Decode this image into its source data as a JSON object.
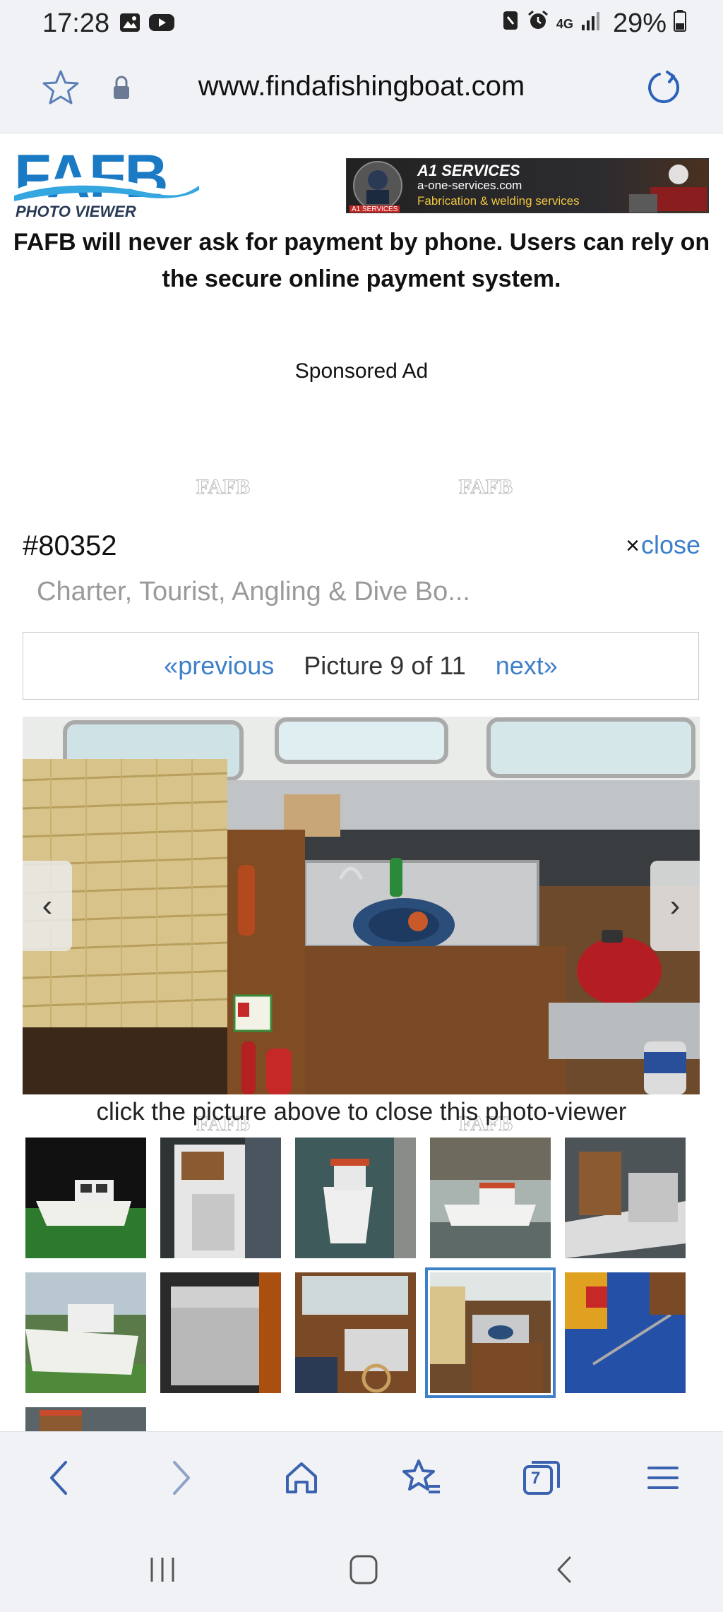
{
  "status_bar": {
    "time": "17:28",
    "battery_percent": "29%",
    "network": "4G",
    "left_icons": [
      "gallery-icon",
      "youtube-icon"
    ],
    "right_icons": [
      "nfc-icon",
      "alarm-icon",
      "data-arrows-icon",
      "signal-icon",
      "battery-icon"
    ]
  },
  "browser": {
    "url": "www.findafishingboat.com",
    "tab_count": "7"
  },
  "site": {
    "logo_text": "FAFB",
    "logo_subtitle": "PHOTO VIEWER",
    "banner": {
      "title": "A1 SERVICES",
      "url": "a-one-services.com",
      "description": "Fabrication & welding services",
      "brand_tag": "A1 SERVICES"
    },
    "notice": "FAFB will never ask for payment by phone. Users can rely on the secure online payment system.",
    "sponsored_label": "Sponsored Ad",
    "watermark": "FAFB"
  },
  "viewer": {
    "listing_id": "#80352",
    "close_x": "×",
    "close_label": "close",
    "title": "Charter, Tourist, Angling & Dive Bo...",
    "prev_label": "«previous",
    "next_label": "next»",
    "picture_counter": "Picture 9 of 11",
    "prev_arrow": "‹",
    "next_arrow": "›",
    "caption": "click the picture above to close this photo-viewer",
    "selected_index": 9,
    "total": 11
  },
  "colors": {
    "link": "#3d7fc9",
    "browser_chrome": "#f1f2f6",
    "logo_blue": "#1a7bc4"
  }
}
